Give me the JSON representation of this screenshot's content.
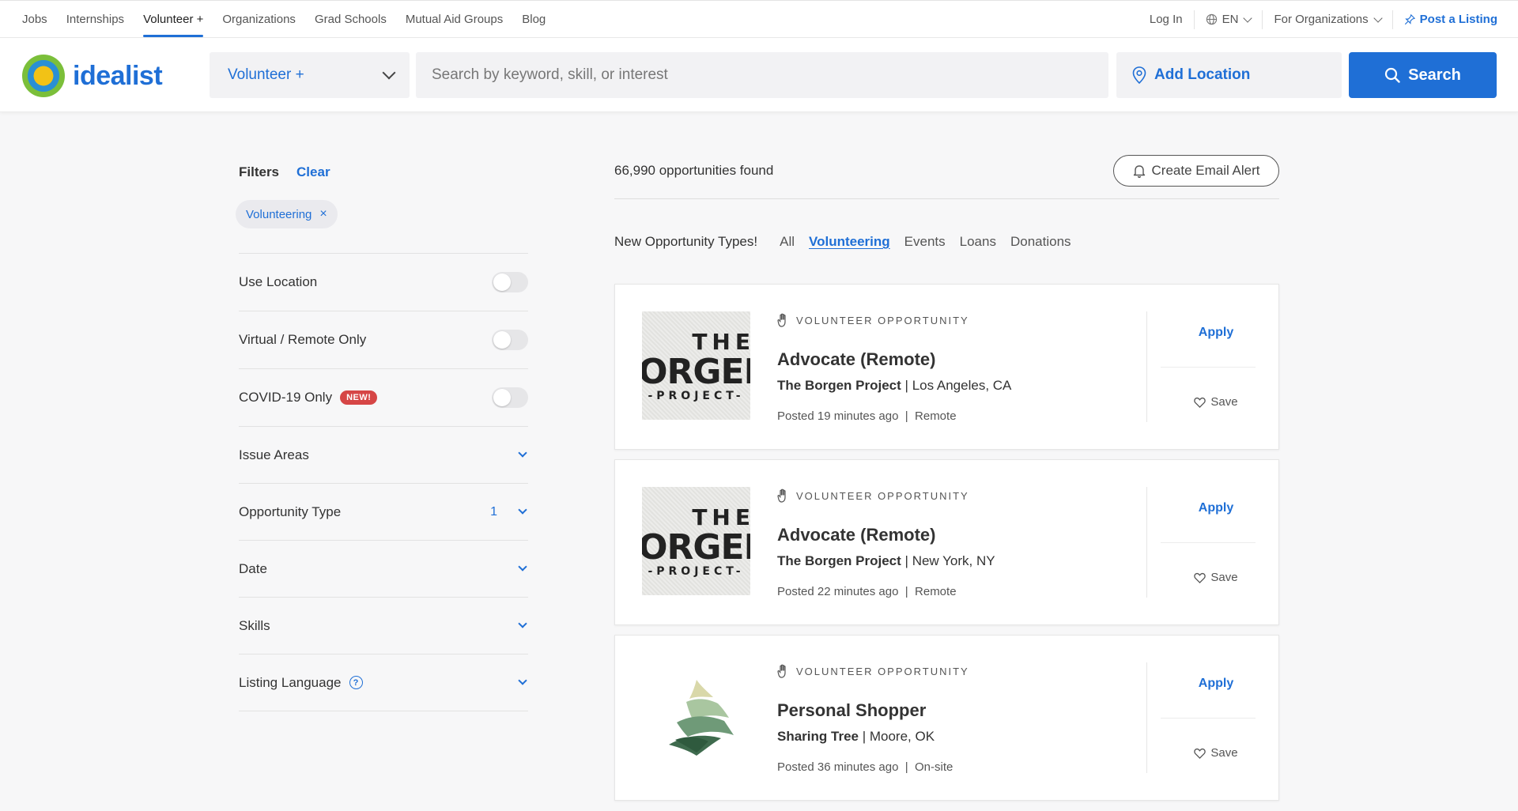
{
  "topnav": {
    "items": [
      "Jobs",
      "Internships",
      "Volunteer +",
      "Organizations",
      "Grad Schools",
      "Mutual Aid Groups",
      "Blog"
    ],
    "login": "Log In",
    "language": "EN",
    "for_orgs": "For Organizations",
    "post_listing": "Post a Listing"
  },
  "header": {
    "logo_text": "idealist",
    "type_select": "Volunteer +",
    "search_placeholder": "Search by keyword, skill, or interest",
    "location": "Add Location",
    "search_button": "Search"
  },
  "filters": {
    "title": "Filters",
    "clear": "Clear",
    "chip": "Volunteering",
    "toggles": [
      {
        "label": "Use Location"
      },
      {
        "label": "Virtual / Remote Only"
      },
      {
        "label": "COVID-19 Only",
        "badge": "NEW!"
      }
    ],
    "accordions": [
      {
        "label": "Issue Areas"
      },
      {
        "label": "Opportunity Type",
        "count": "1"
      },
      {
        "label": "Date"
      },
      {
        "label": "Skills"
      },
      {
        "label": "Listing Language"
      }
    ]
  },
  "results": {
    "count_text": "66,990 opportunities found",
    "alert_button": "Create Email Alert",
    "types_label": "New Opportunity Types!",
    "types": [
      "All",
      "Volunteering",
      "Events",
      "Loans",
      "Donations"
    ],
    "active_type": "Volunteering"
  },
  "listings": [
    {
      "type": "VOLUNTEER OPPORTUNITY",
      "title": "Advocate (Remote)",
      "org": "The Borgen Project",
      "location": "Los Angeles, CA",
      "posted": "Posted 19 minutes ago",
      "mode": "Remote",
      "apply": "Apply",
      "save": "Save"
    },
    {
      "type": "VOLUNTEER OPPORTUNITY",
      "title": "Advocate (Remote)",
      "org": "The Borgen Project",
      "location": "New York, NY",
      "posted": "Posted 22 minutes ago",
      "mode": "Remote",
      "apply": "Apply",
      "save": "Save"
    },
    {
      "type": "VOLUNTEER OPPORTUNITY",
      "title": "Personal Shopper",
      "org": "Sharing Tree",
      "location": "Moore, OK",
      "posted": "Posted 36 minutes ago",
      "mode": "On-site",
      "apply": "Apply",
      "save": "Save"
    }
  ],
  "logos": {
    "borgen": {
      "top": "THE",
      "mid": "BORGEN",
      "bottom": "-PROJECT-"
    }
  },
  "colors": {
    "brand_blue": "#1f6fd6",
    "badge_red": "#d64646"
  }
}
